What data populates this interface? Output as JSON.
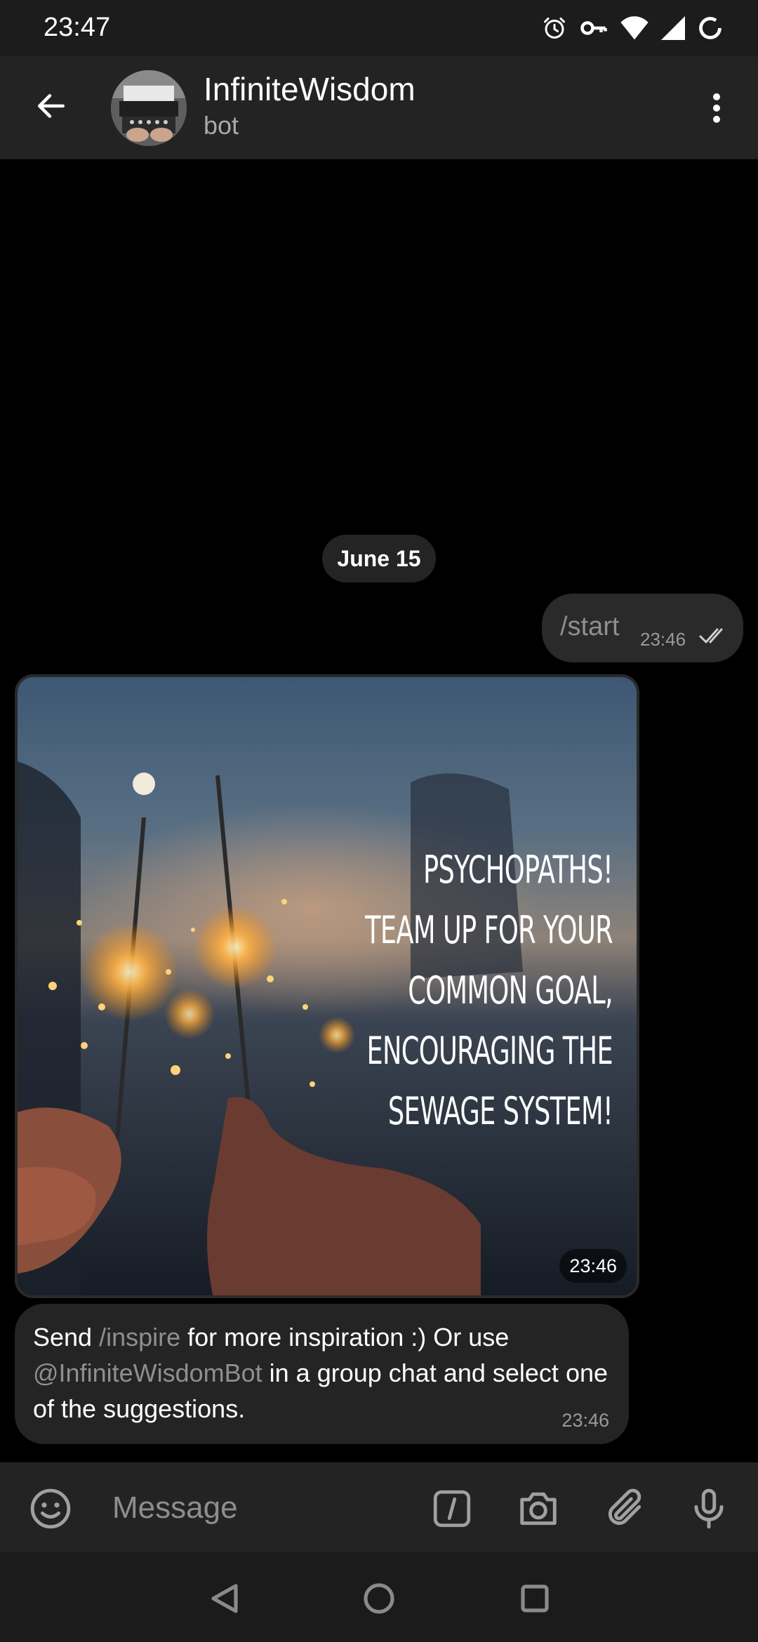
{
  "status_bar": {
    "time": "23:47",
    "icons": [
      "alarm-icon",
      "vpn-key-icon",
      "wifi-icon",
      "signal-icon",
      "battery-saver-icon"
    ]
  },
  "header": {
    "title": "InfiniteWisdom",
    "subtitle": "bot",
    "back_icon": "arrow-left-icon",
    "menu_icon": "more-vert-icon"
  },
  "chat": {
    "date_chip": "June 15",
    "outgoing": {
      "text": "/start",
      "time": "23:46",
      "status": "read"
    },
    "photo_message": {
      "quote_lines": [
        "Psychopaths!",
        "Team up for your",
        "common goal,",
        "encouraging the",
        "sewage system!"
      ],
      "time": "23:46"
    },
    "text_message": {
      "part1": "Send ",
      "command": "/inspire",
      "part2": " for more inspiration :) Or use ",
      "mention": "@InfiniteWisdomBot",
      "part3": " in a group chat and select one of the suggestions.",
      "time": "23:46"
    }
  },
  "input_bar": {
    "placeholder": "Message",
    "icons": [
      "emoji-icon",
      "bot-command-icon",
      "camera-icon",
      "attach-icon",
      "microphone-icon"
    ]
  },
  "nav_bar": {
    "icons": [
      "nav-back-icon",
      "nav-home-icon",
      "nav-recents-icon"
    ]
  },
  "colors": {
    "background": "#000000",
    "header": "#232323",
    "bubble": "#242424",
    "muted_text": "#8f8f8f"
  }
}
